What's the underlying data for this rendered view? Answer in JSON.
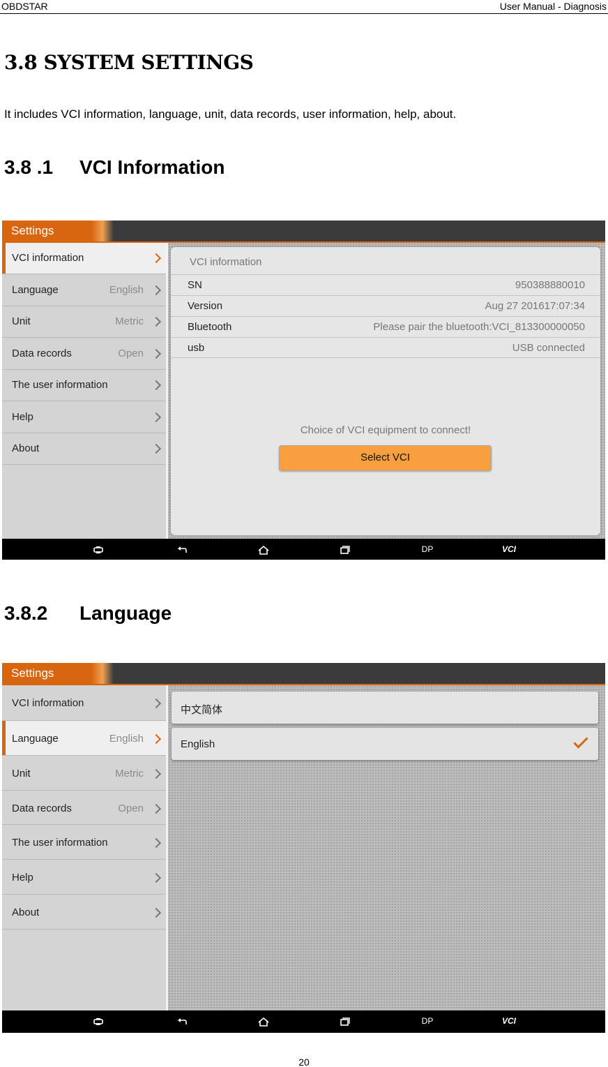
{
  "header": {
    "left": "OBDSTAR",
    "right": "User Manual - Diagnosis"
  },
  "section": {
    "title": "3.8 SYSTEM SETTINGS",
    "intro": "It includes VCI information, language, unit, data records, user information, help, about."
  },
  "sub1": {
    "number": "3.8 .1",
    "title": "VCI Information"
  },
  "sub2": {
    "number": "3.8.2",
    "title": "Language"
  },
  "app": {
    "title": "Settings",
    "menu": [
      {
        "label": "VCI information",
        "value": ""
      },
      {
        "label": "Language",
        "value": "English"
      },
      {
        "label": "Unit",
        "value": "Metric"
      },
      {
        "label": "Data records",
        "value": "Open"
      },
      {
        "label": "The user information",
        "value": ""
      },
      {
        "label": "Help",
        "value": ""
      },
      {
        "label": "About",
        "value": ""
      }
    ],
    "nav": [
      "DP",
      "VCI"
    ]
  },
  "vci_panel": {
    "title": "VCI information",
    "rows": [
      {
        "key": "SN",
        "value": "950388880010"
      },
      {
        "key": "Version",
        "value": "Aug 27 201617:07:34"
      },
      {
        "key": "Bluetooth",
        "value": "Please pair the bluetooth:VCI_813300000050"
      },
      {
        "key": "usb",
        "value": "USB connected"
      }
    ],
    "choice_text": "Choice of VCI equipment to connect!",
    "button": "Select VCI"
  },
  "language_panel": {
    "options": [
      {
        "label": "中文简体",
        "selected": false
      },
      {
        "label": "English",
        "selected": true
      }
    ]
  },
  "page_number": "20",
  "colors": {
    "accent": "#d8650f",
    "button": "#f8a040",
    "titlebar": "#3b3b3b"
  }
}
